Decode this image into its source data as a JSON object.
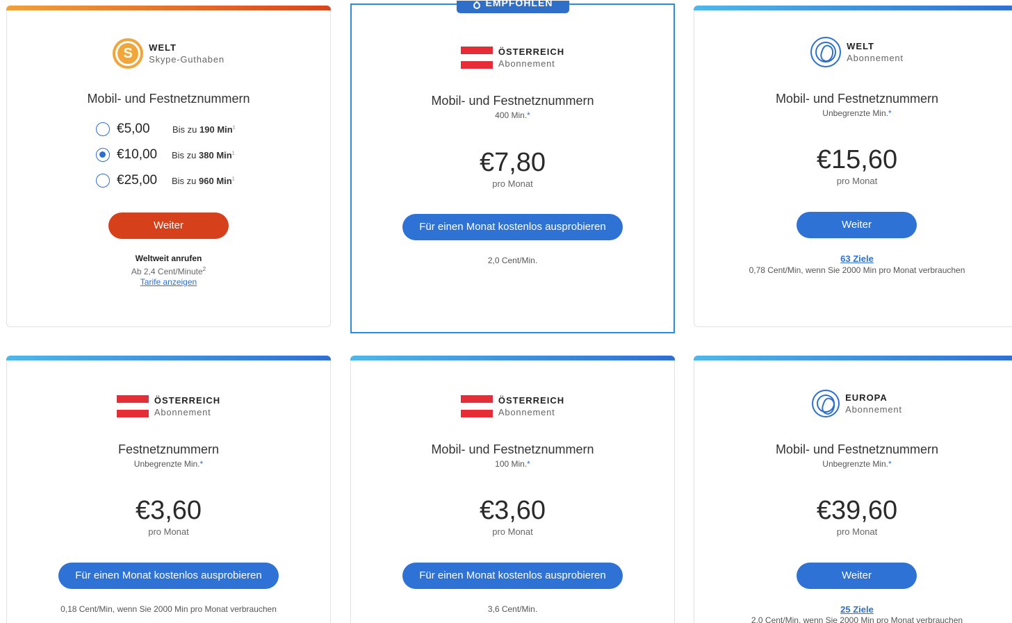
{
  "cards": [
    {
      "region": "WELT",
      "kind": "Skype-Guthaben",
      "title": "Mobil- und Festnetznummern",
      "options": [
        {
          "amount": "€5,00",
          "prefix": "Bis zu",
          "minutes": "190 Min",
          "sup": "1",
          "selected": false
        },
        {
          "amount": "€10,00",
          "prefix": "Bis zu",
          "minutes": "380 Min",
          "sup": "1",
          "selected": true
        },
        {
          "amount": "€25,00",
          "prefix": "Bis zu",
          "minutes": "960 Min",
          "sup": "1",
          "selected": false
        }
      ],
      "button": "Weiter",
      "world_call": "Weltweit anrufen",
      "rate_note": "Ab 2,4 Cent/Minute",
      "rate_sup": "2",
      "link": "Tarife anzeigen"
    },
    {
      "ribbon": "EMPFOHLEN",
      "region": "ÖSTERREICH",
      "kind": "Abonnement",
      "title": "Mobil- und Festnetznummern",
      "sub": "400 Min.",
      "price": "€7,80",
      "per": "pro Monat",
      "button": "Für einen Monat kostenlos ausprobieren",
      "note": "2,0 Cent/Min."
    },
    {
      "region": "WELT",
      "kind": "Abonnement",
      "title": "Mobil- und Festnetznummern",
      "sub": "Unbegrenzte Min.",
      "price": "€15,60",
      "per": "pro Monat",
      "button": "Weiter",
      "link": "63 Ziele",
      "note": "0,78 Cent/Min, wenn Sie 2000 Min pro Monat verbrauchen"
    },
    {
      "region": "ÖSTERREICH",
      "kind": "Abonnement",
      "title": "Festnetznummern",
      "sub": "Unbegrenzte Min.",
      "price": "€3,60",
      "per": "pro Monat",
      "button": "Für einen Monat kostenlos ausprobieren",
      "note": "0,18 Cent/Min, wenn Sie 2000 Min pro Monat verbrauchen"
    },
    {
      "region": "ÖSTERREICH",
      "kind": "Abonnement",
      "title": "Mobil- und Festnetznummern",
      "sub": "100 Min.",
      "price": "€3,60",
      "per": "pro Monat",
      "button": "Für einen Monat kostenlos ausprobieren",
      "note": "3,6 Cent/Min."
    },
    {
      "region": "EUROPA",
      "kind": "Abonnement",
      "title": "Mobil- und Festnetznummern",
      "sub": "Unbegrenzte Min.",
      "price": "€39,60",
      "per": "pro Monat",
      "button": "Weiter",
      "link": "25 Ziele",
      "note": "2,0 Cent/Min, wenn Sie 2000 Min pro Monat verbrauchen"
    }
  ],
  "star": "*",
  "colors": {
    "accent": "#2f72d6",
    "orange_button": "#d6401a",
    "flag_red": "#e52c37"
  }
}
